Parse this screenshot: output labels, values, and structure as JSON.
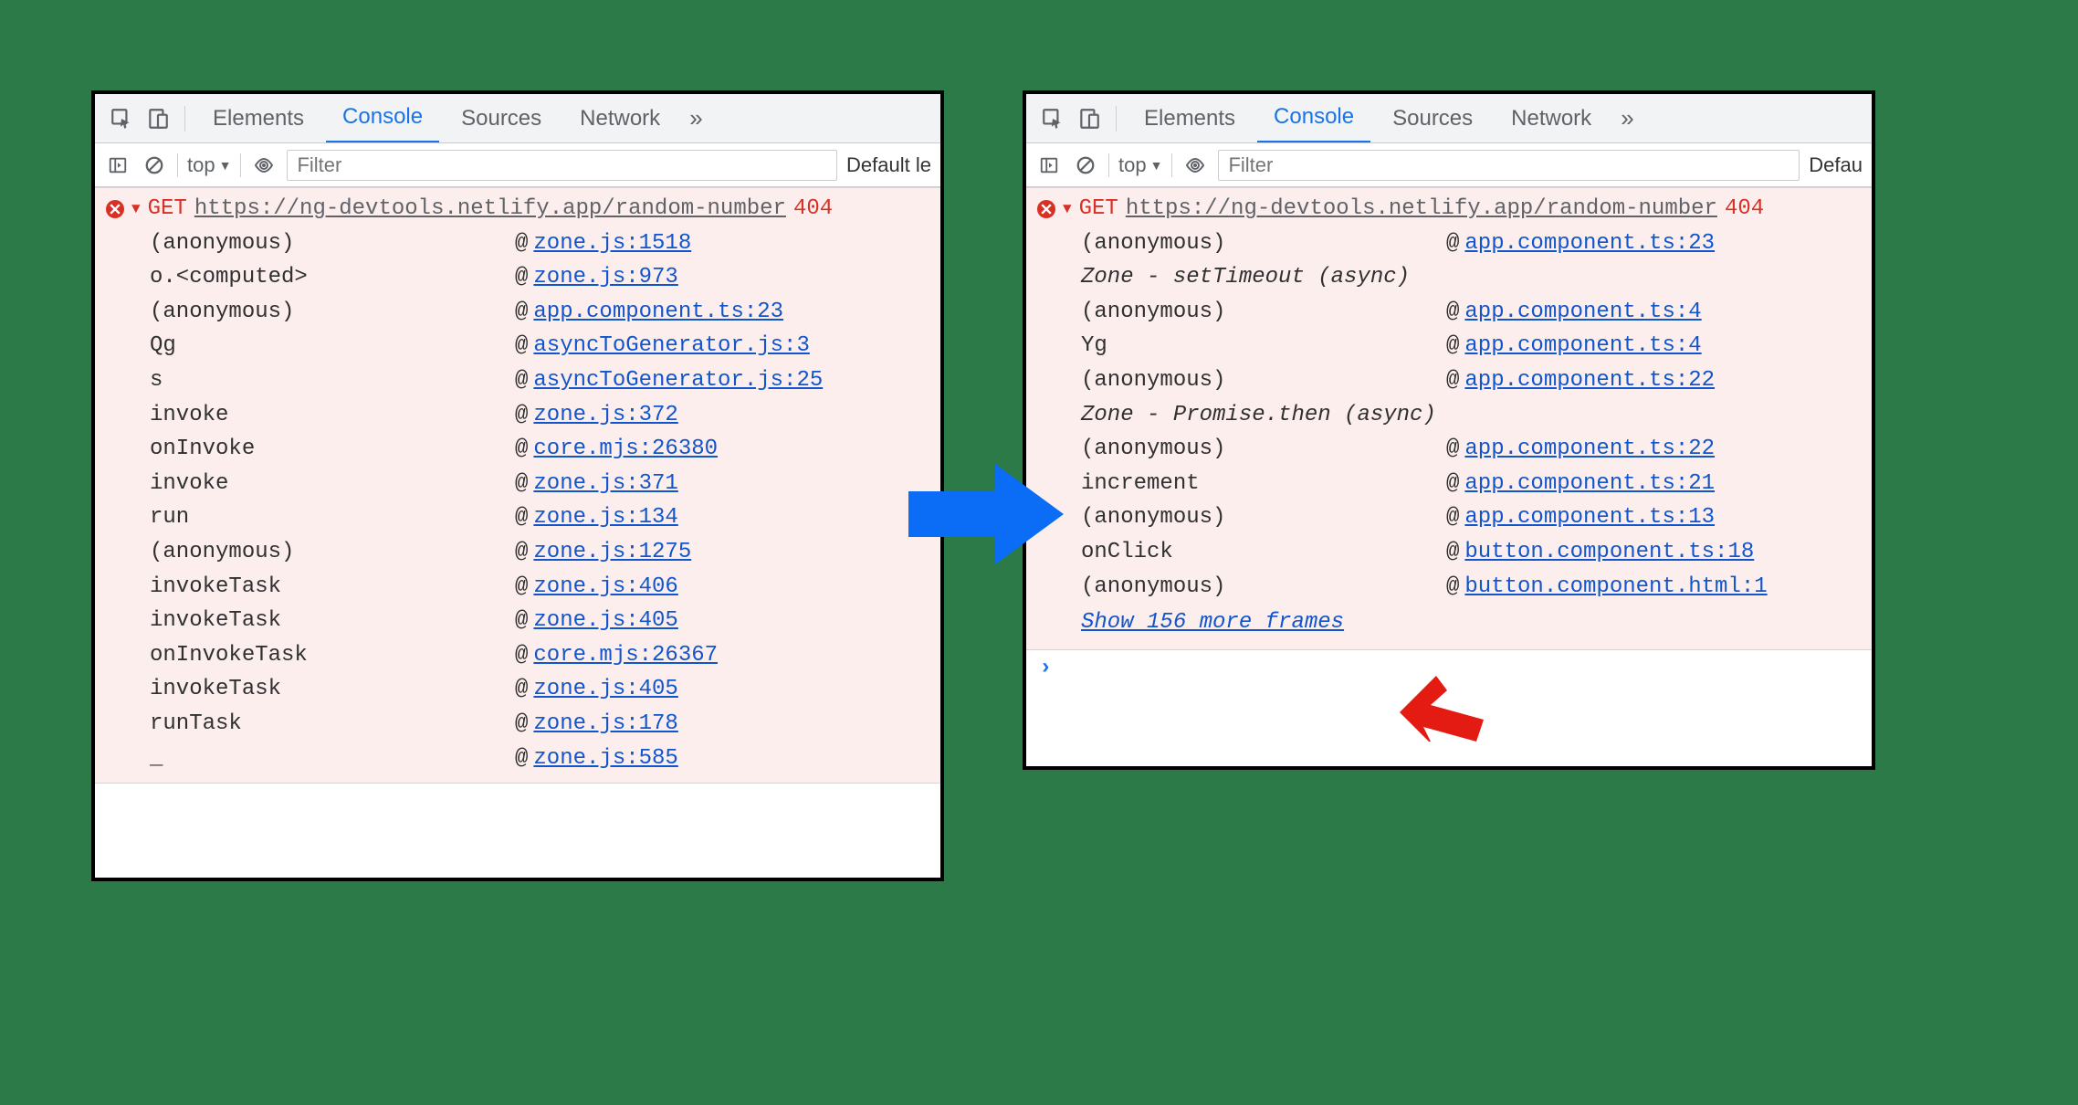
{
  "tabs": [
    "Elements",
    "Console",
    "Sources",
    "Network"
  ],
  "active_tab": "Console",
  "toolbar": {
    "context": "top",
    "filter_placeholder": "Filter",
    "level_label_left": "Default le",
    "level_label_right": "Defau"
  },
  "left": {
    "method": "GET",
    "url": "https://ng-devtools.netlify.app/random-number",
    "status": "404",
    "stack": [
      {
        "fn": "(anonymous)",
        "link": "zone.js:1518"
      },
      {
        "fn": "o.<computed>",
        "link": "zone.js:973"
      },
      {
        "fn": "(anonymous)",
        "link": "app.component.ts:23"
      },
      {
        "fn": "Qg",
        "link": "asyncToGenerator.js:3"
      },
      {
        "fn": "s",
        "link": "asyncToGenerator.js:25"
      },
      {
        "fn": "invoke",
        "link": "zone.js:372"
      },
      {
        "fn": "onInvoke",
        "link": "core.mjs:26380"
      },
      {
        "fn": "invoke",
        "link": "zone.js:371"
      },
      {
        "fn": "run",
        "link": "zone.js:134"
      },
      {
        "fn": "(anonymous)",
        "link": "zone.js:1275"
      },
      {
        "fn": "invokeTask",
        "link": "zone.js:406"
      },
      {
        "fn": "invokeTask",
        "link": "zone.js:405"
      },
      {
        "fn": "onInvokeTask",
        "link": "core.mjs:26367"
      },
      {
        "fn": "invokeTask",
        "link": "zone.js:405"
      },
      {
        "fn": "runTask",
        "link": "zone.js:178"
      },
      {
        "fn": "_",
        "link": "zone.js:585"
      }
    ]
  },
  "right": {
    "method": "GET",
    "url": "https://ng-devtools.netlify.app/random-number",
    "status": "404",
    "sections": [
      {
        "type": "frame",
        "fn": "(anonymous)",
        "link": "app.component.ts:23"
      },
      {
        "type": "zone",
        "label": "Zone - setTimeout (async)"
      },
      {
        "type": "frame",
        "fn": "(anonymous)",
        "link": "app.component.ts:4"
      },
      {
        "type": "frame",
        "fn": "Yg",
        "link": "app.component.ts:4"
      },
      {
        "type": "frame",
        "fn": "(anonymous)",
        "link": "app.component.ts:22"
      },
      {
        "type": "zone",
        "label": "Zone - Promise.then (async)"
      },
      {
        "type": "frame",
        "fn": "(anonymous)",
        "link": "app.component.ts:22"
      },
      {
        "type": "frame",
        "fn": "increment",
        "link": "app.component.ts:21"
      },
      {
        "type": "frame",
        "fn": "(anonymous)",
        "link": "app.component.ts:13"
      },
      {
        "type": "frame",
        "fn": "onClick",
        "link": "button.component.ts:18"
      },
      {
        "type": "frame",
        "fn": "(anonymous)",
        "link": "button.component.html:1"
      }
    ],
    "show_more": "Show 156 more frames"
  }
}
